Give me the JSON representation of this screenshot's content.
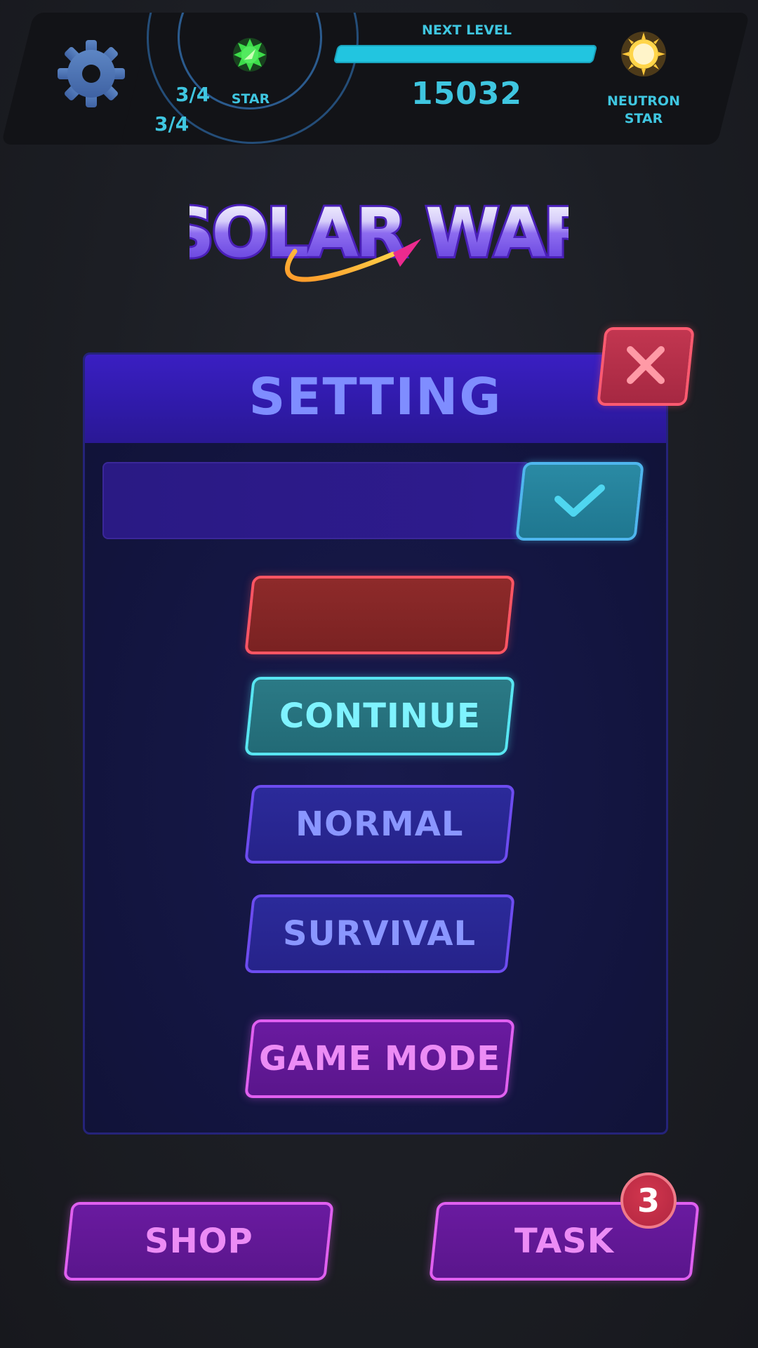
{
  "hud": {
    "star_fraction_1": "3/4",
    "star_fraction_2": "3/4",
    "star_label": "STAR",
    "next_level_label": "NEXT LEVEL",
    "level_progress": 1.0,
    "score": "15032",
    "next_rank_label_line1": "NEUTRON",
    "next_rank_label_line2": "STAR"
  },
  "logo": {
    "text": "SOLAR WAR"
  },
  "setting_panel": {
    "title": "SETTING",
    "name_input": {
      "value": "",
      "placeholder": ""
    },
    "buttons": {
      "red_button_label": "",
      "continue_label": "CONTINUE",
      "normal_label": "NORMAL",
      "survival_label": "SURVIVAL",
      "game_mode_label": "GAME MODE"
    }
  },
  "bottom": {
    "shop_label": "SHOP",
    "task_label": "TASK",
    "task_badge_count": "3"
  },
  "icons": {
    "settings": "gear-icon",
    "star": "green-star-icon",
    "next_rank": "sun-icon",
    "close": "close-icon",
    "confirm": "checkmark-icon"
  },
  "colors": {
    "accent_cyan": "#22c5e0",
    "panel_header": "#3a1fc2",
    "close_red": "#c23650",
    "magenta": "#e060f0"
  }
}
